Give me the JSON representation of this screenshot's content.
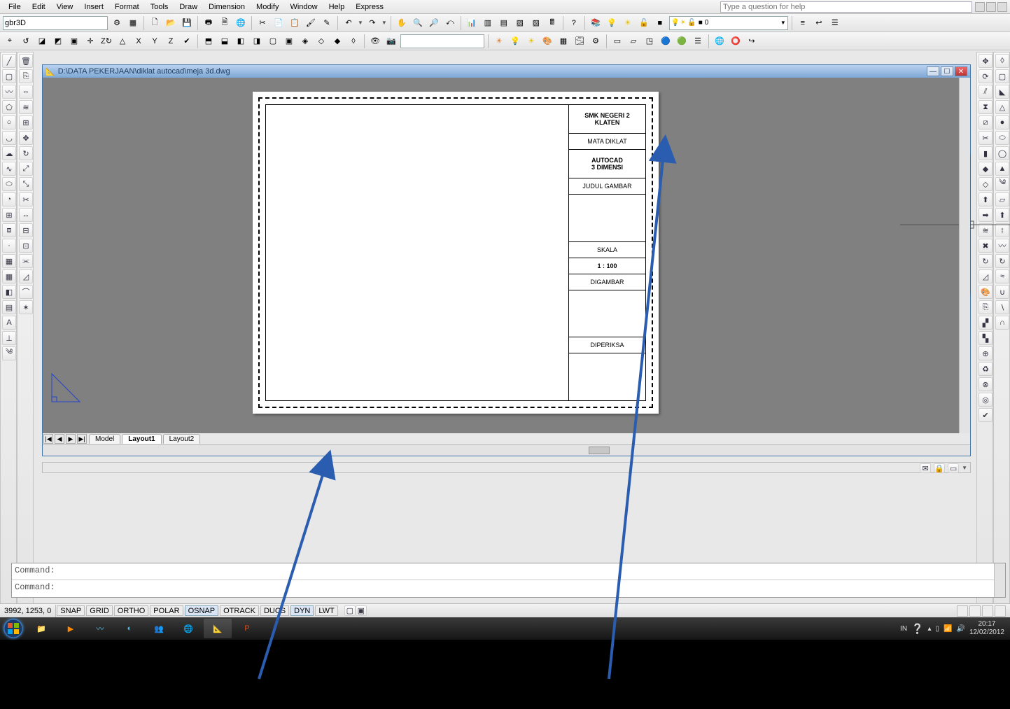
{
  "menu": {
    "items": [
      "File",
      "Edit",
      "View",
      "Insert",
      "Format",
      "Tools",
      "Draw",
      "Dimension",
      "Modify",
      "Window",
      "Help",
      "Express"
    ],
    "help_placeholder": "Type a question for help"
  },
  "toolbar1": {
    "layer_name_input": "gbr3D",
    "layer_combo_value": "0"
  },
  "drawing": {
    "title": "D:\\DATA PEKERJAAN\\diklat autocad\\meja 3d.dwg",
    "tabs": {
      "nav": [
        "|◀",
        "◀",
        "▶",
        "▶|"
      ],
      "model": "Model",
      "layout1": "Layout1",
      "layout2": "Layout2"
    },
    "titleblock": {
      "school1": "SMK NEGERI 2",
      "school2": "KLATEN",
      "mata": "MATA DIKLAT",
      "subject1": "AUTOCAD",
      "subject2": "3 DIMENSI",
      "judul": "JUDUL GAMBAR",
      "skala_h": "SKALA",
      "skala_v": "1 : 100",
      "digambar": "DIGAMBAR",
      "diperiksa": "DIPERIKSA"
    }
  },
  "command": {
    "label1": "Command:",
    "label2": "Command:"
  },
  "status": {
    "coords": "3992, 1253, 0",
    "toggles": [
      "SNAP",
      "GRID",
      "ORTHO",
      "POLAR",
      "OSNAP",
      "OTRACK",
      "DUCS",
      "DYN",
      "LWT"
    ],
    "active": [
      "OSNAP",
      "DYN"
    ]
  },
  "taskbar": {
    "lang": "IN",
    "time": "20:17",
    "date": "12/02/2012"
  },
  "icons": {
    "line": "╱",
    "pline": "〰",
    "circle": "○",
    "arc": "◡",
    "rect": "▭",
    "ellipse": "⬭",
    "hatch": "▦",
    "text": "A",
    "point": "·",
    "spline": "∿",
    "region": "◧",
    "table": "▤",
    "copy": "⎘",
    "mirror": "⇔",
    "offset": "≋",
    "array": "⊞",
    "move": "✥",
    "rotate": "↻",
    "scale": "⤢",
    "trim": "✂",
    "extend": "↔",
    "fillet": "⌒",
    "explode": "✶",
    "new": "🗋",
    "open": "📂",
    "save": "💾",
    "print": "🖶",
    "cut": "✂",
    "paste": "📋",
    "undo": "↶",
    "redo": "↷",
    "zoom": "🔍"
  }
}
